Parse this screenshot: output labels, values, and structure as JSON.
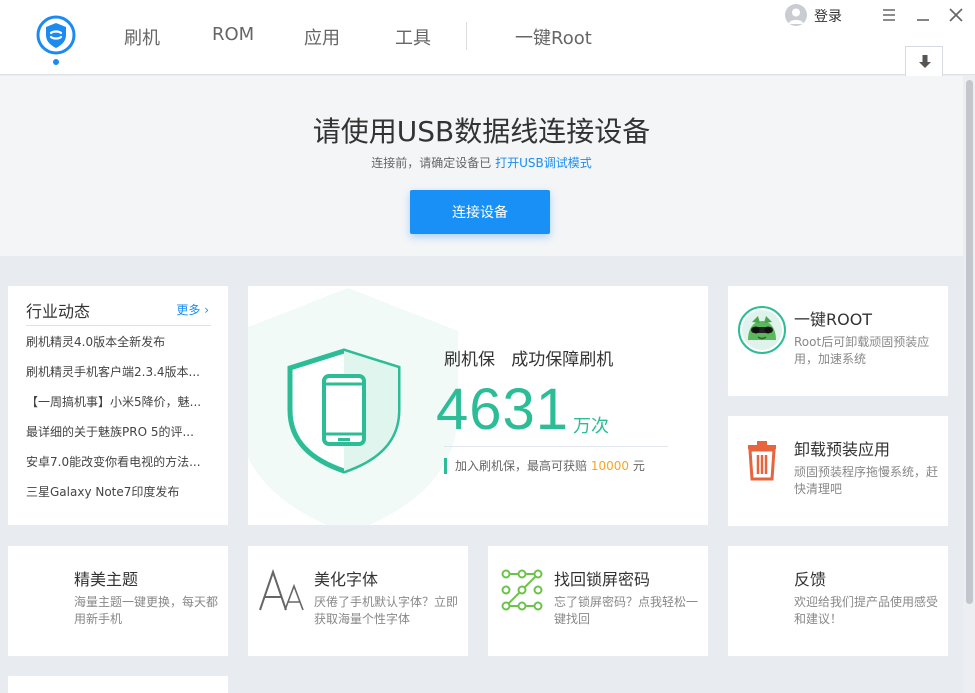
{
  "nav": {
    "items": [
      "刷机",
      "ROM",
      "应用",
      "工具"
    ],
    "root": "一键Root"
  },
  "user": {
    "login": "登录"
  },
  "banner": {
    "title": "请使用USB数据线连接设备",
    "sub_prefix": "连接前，请确定设备已",
    "sub_link": "打开USB调试模式",
    "button": "连接设备"
  },
  "news": {
    "title": "行业动态",
    "more": "更多",
    "items": [
      "刷机精灵4.0版本全新发布",
      "刷机精灵手机客户端2.3.4版本...",
      "【一周搞机事】小米5降价，魅...",
      "最详细的关于魅族PRO 5的评...",
      "安卓7.0能改变你看电视的方法...",
      "三星Galaxy Note7印度发布"
    ]
  },
  "shuaji": {
    "title": "刷机保   成功保障刷机",
    "count": "4631",
    "unit": "万次",
    "note_prefix": "加入刷机保，最高可获赔",
    "note_amount": "10000",
    "note_suffix": "元"
  },
  "features": {
    "root": {
      "title": "一键ROOT",
      "desc": "Root后可卸载顽固预装应用，加速系统"
    },
    "uninstall": {
      "title": "卸载预装应用",
      "desc": "顽固预装程序拖慢系统，赶快清理吧"
    },
    "theme": {
      "title": "精美主题",
      "desc": "海量主题一键更换，每天都用新手机"
    },
    "font": {
      "title": "美化字体",
      "desc": "厌倦了手机默认字体？立即获取海量个性字体"
    },
    "lock": {
      "title": "找回锁屏密码",
      "desc": "忘了锁屏密码？点我轻松一键找回"
    },
    "feedback": {
      "title": "反馈",
      "desc": "欢迎给我们提产品使用感受和建议！"
    }
  },
  "colors": {
    "brand_blue": "#1890f5",
    "shield_green": "#2dbd96",
    "highlight_orange": "#f5a623",
    "trash_orange": "#e8643c"
  }
}
